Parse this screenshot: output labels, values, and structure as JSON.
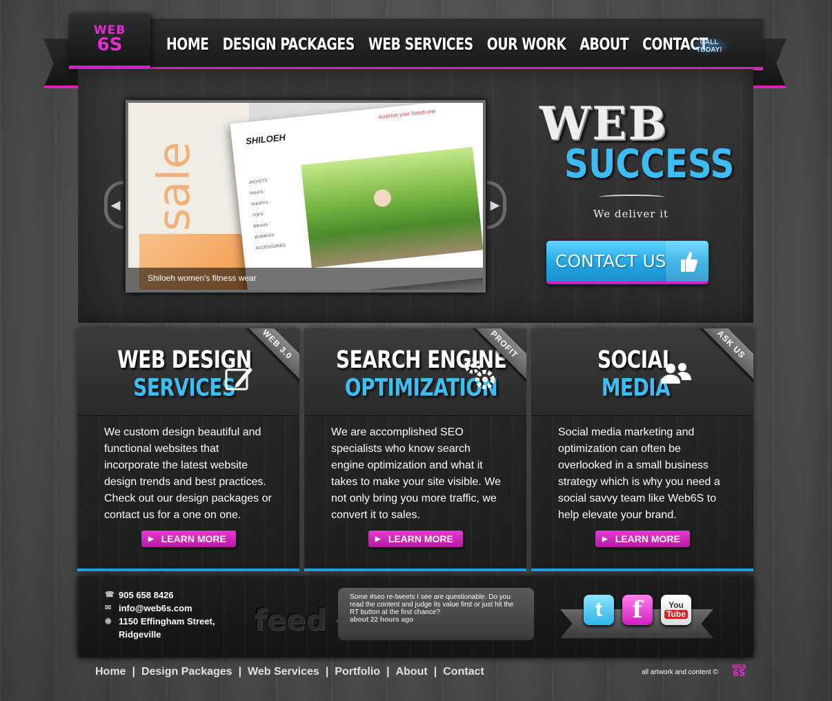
{
  "logo": {
    "line1": "WEB",
    "line2": "6S"
  },
  "nav": {
    "items": [
      "HOME",
      "DESIGN PACKAGES",
      "WEB SERVICES",
      "OUR WORK",
      "ABOUT",
      "CONTACT"
    ],
    "call_line1": "CALL",
    "call_line2": "TODAY!"
  },
  "slider": {
    "caption": "Shiloeh women's fitness wear",
    "slide_brand": "SHILOEH",
    "slide_sale": "sale",
    "slide_tag": "surprise your loved one",
    "slide_menu": [
      "JACKETS",
      "PANTS",
      "SHORTS",
      "TOPS",
      "BIKINIS",
      "WOMEN'S ACCESSORIES"
    ]
  },
  "hero": {
    "headline1": "WEB",
    "headline2": "SUCCESS",
    "tagline": "We deliver it",
    "contact_button": "CONTACT US"
  },
  "services": [
    {
      "title1": "WEB DESIGN",
      "title2": "SERVICES",
      "ribbon": "WEB 3.0",
      "icon": "tablet-pen-icon",
      "text": "We custom design beautiful and functional websites that incorporate the latest website design trends and best practices. Check out our design packages or contact us for a one on one.",
      "button": "LEARN MORE"
    },
    {
      "title1": "SEARCH ENGINE",
      "title2": "OPTIMIZATION",
      "ribbon": "PROFIT",
      "icon": "gears-icon",
      "text": "We are accomplished SEO specialists who know search engine optimization and what it takes to make your site visible. We not only bring you more traffic, we convert it to sales.",
      "button": "LEARN MORE"
    },
    {
      "title1": "SOCIAL",
      "title2": "MEDIA",
      "ribbon": "ASK US",
      "icon": "users-icon",
      "text": "Social media marketing and optimization can often be overlooked in a small business strategy which is why you need a social savvy team like Web6S to help elevate your brand.",
      "button": "LEARN MORE"
    }
  ],
  "contact": {
    "phone": "905 658 8426",
    "email": "info@web6s.com",
    "address1": "1150 Effingham Street,",
    "address2": "Ridgeville"
  },
  "feed": {
    "label": "feed",
    "tweet": "Some #seo re-tweets I see are questionable. Do you read the content and judge its value first or just hit the RT button at the first chance?",
    "time": "about 22 hours ago"
  },
  "social": {
    "twitter": "t",
    "facebook": "f",
    "youtube_top": "You",
    "youtube_bottom": "Tube"
  },
  "footer": {
    "links": [
      "Home",
      "Design Packages",
      "Web Services",
      "Portfolio",
      "About",
      "Contact"
    ],
    "separator": "|",
    "copyright": "all artwork and content ©",
    "logo_line1": "WEB",
    "logo_line2": "6S"
  },
  "colors": {
    "accent_pink": "#d61fc0",
    "accent_blue": "#3bbcf2"
  }
}
